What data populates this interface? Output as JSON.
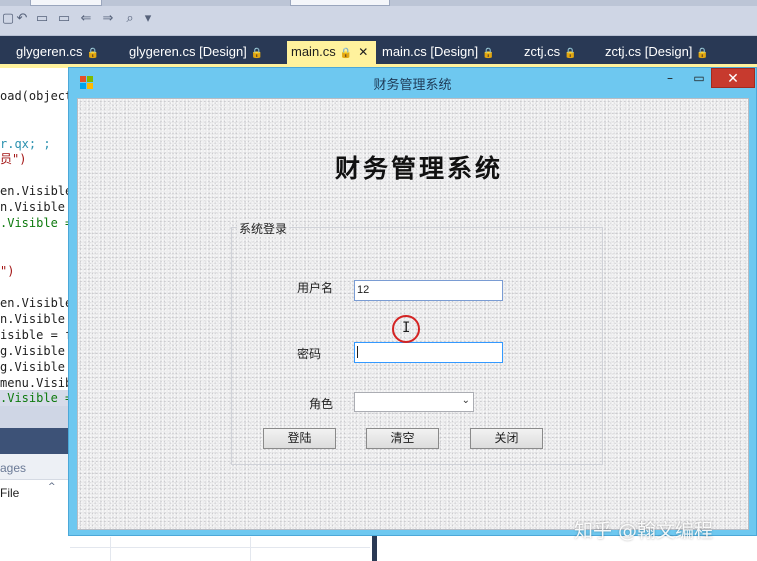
{
  "ide": {
    "tabs": [
      {
        "label": "glygeren.cs",
        "lock": "🔒"
      },
      {
        "label": "glygeren.cs [Design]",
        "lock": "🔒"
      },
      {
        "label": "main.cs",
        "lock": "🔒",
        "close": "✕"
      },
      {
        "label": "main.cs [Design]",
        "lock": "🔒"
      },
      {
        "label": "zctj.cs",
        "lock": "🔒"
      },
      {
        "label": "zctj.cs [Design]",
        "lock": "🔒"
      }
    ],
    "active_tab_color": "#fff29d",
    "code_lines": [
      "oad(object",
      "r.qx; ;",
      "员\")",
      "en.Visible",
      "n.Visible",
      ".Visible =",
      "\")",
      "en.Visible",
      "n.Visible",
      "isible = f",
      "g.Visible",
      "g.Visible",
      "menu.Visib",
      ".Visible ="
    ],
    "tool_panel": {
      "header": "ages",
      "row": "File",
      "caret": "^"
    }
  },
  "form": {
    "window_title": "财务管理系统",
    "min_glyph": "–",
    "max_glyph": "▭",
    "close_glyph": "✕",
    "banner": "财务管理系统",
    "group_title": "系统登录",
    "username_label": "用户名",
    "username_value": "12",
    "password_label": "密码",
    "password_value": "",
    "role_label": "角色",
    "role_value": "",
    "role_arrow": "⌄",
    "buttons": {
      "login": "登陆",
      "clear": "清空",
      "close": "关闭"
    },
    "titlebar_color": "#6ec8f0",
    "close_button_color": "#c73a2e"
  },
  "cursor": {
    "glyph": "I"
  },
  "watermark": "知乎 @翰文编程"
}
